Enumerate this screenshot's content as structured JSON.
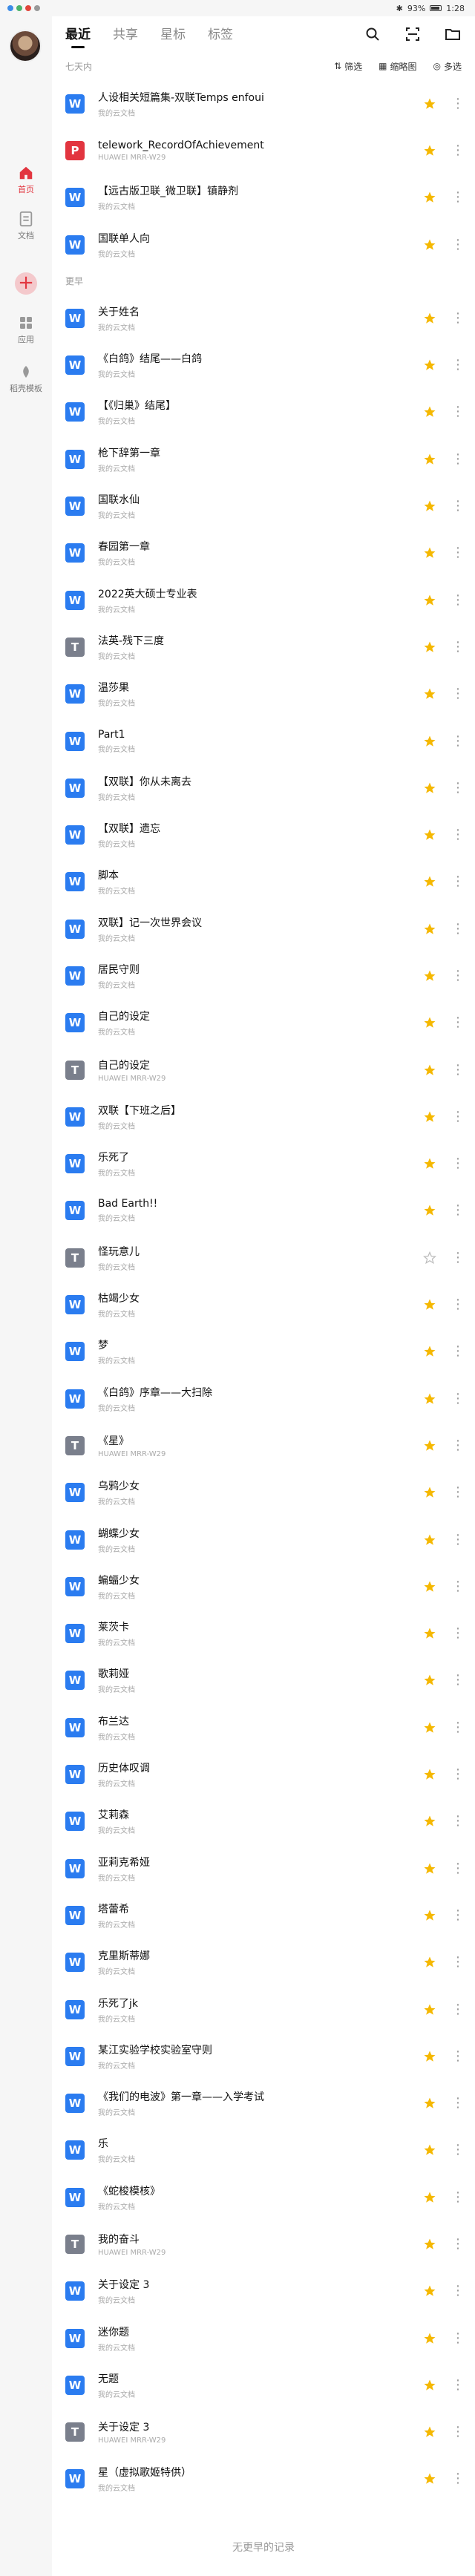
{
  "statusbar": {
    "battery": "93%",
    "time": "1:28"
  },
  "sidebar": {
    "items": [
      {
        "label": "首页",
        "icon": "home-icon"
      },
      {
        "label": "文档",
        "icon": "document-icon"
      },
      {
        "label": "应用",
        "icon": "apps-icon"
      },
      {
        "label": "稻壳模板",
        "icon": "template-icon"
      }
    ],
    "add_label": "+"
  },
  "tabs": [
    "最近",
    "共享",
    "星标",
    "标签"
  ],
  "toolbar": {
    "filter_label": "筛选",
    "thumb_label": "缩略图",
    "multi_label": "多选"
  },
  "sections": [
    {
      "title": "七天内",
      "items": [
        {
          "name": "人设相关短篇集-双联Temps enfoui",
          "sub": "我的云文档",
          "type": "w",
          "starred": true
        },
        {
          "name": "telework_RecordOfAchievement",
          "sub": "HUAWEI MRR-W29",
          "type": "p",
          "starred": true
        },
        {
          "name": "【远古版卫联_微卫联】镇静剂",
          "sub": "我的云文档",
          "type": "w",
          "starred": true
        },
        {
          "name": "国联单人向",
          "sub": "我的云文档",
          "type": "w",
          "starred": true
        }
      ]
    },
    {
      "title": "更早",
      "items": [
        {
          "name": "关于姓名",
          "sub": "我的云文档",
          "type": "w",
          "starred": true
        },
        {
          "name": "《白鸽》结尾——白鸽",
          "sub": "我的云文档",
          "type": "w",
          "starred": true
        },
        {
          "name": "【《归巢》结尾】",
          "sub": "我的云文档",
          "type": "w",
          "starred": true
        },
        {
          "name": "枪下辞第一章",
          "sub": "我的云文档",
          "type": "w",
          "starred": true
        },
        {
          "name": "国联水仙",
          "sub": "我的云文档",
          "type": "w",
          "starred": true
        },
        {
          "name": "春园第一章",
          "sub": "我的云文档",
          "type": "w",
          "starred": true
        },
        {
          "name": "2022英大硕士专业表",
          "sub": "我的云文档",
          "type": "w",
          "starred": true
        },
        {
          "name": "法英-残下三度",
          "sub": "我的云文档",
          "type": "t",
          "starred": true
        },
        {
          "name": "温莎果",
          "sub": "我的云文档",
          "type": "w",
          "starred": true
        },
        {
          "name": "Part1",
          "sub": "我的云文档",
          "type": "w",
          "starred": true
        },
        {
          "name": "【双联】你从未离去",
          "sub": "我的云文档",
          "type": "w",
          "starred": true
        },
        {
          "name": "【双联】遗忘",
          "sub": "我的云文档",
          "type": "w",
          "starred": true
        },
        {
          "name": "脚本",
          "sub": "我的云文档",
          "type": "w",
          "starred": true
        },
        {
          "name": "双联】记一次世界会议",
          "sub": "我的云文档",
          "type": "w",
          "starred": true
        },
        {
          "name": "居民守则",
          "sub": "我的云文档",
          "type": "w",
          "starred": true
        },
        {
          "name": "自己的设定",
          "sub": "我的云文档",
          "type": "w",
          "starred": true
        },
        {
          "name": "自己的设定",
          "sub": "HUAWEI MRR-W29",
          "type": "t",
          "starred": true
        },
        {
          "name": "双联【下班之后】",
          "sub": "我的云文档",
          "type": "w",
          "starred": true
        },
        {
          "name": "乐死了",
          "sub": "我的云文档",
          "type": "w",
          "starred": true
        },
        {
          "name": "Bad Earth!!",
          "sub": "我的云文档",
          "type": "w",
          "starred": true
        },
        {
          "name": "怪玩意儿",
          "sub": "我的云文档",
          "type": "t",
          "starred": false
        },
        {
          "name": "枯竭少女",
          "sub": "我的云文档",
          "type": "w",
          "starred": true
        },
        {
          "name": "梦",
          "sub": "我的云文档",
          "type": "w",
          "starred": true
        },
        {
          "name": "《白鸽》序章——大扫除",
          "sub": "我的云文档",
          "type": "w",
          "starred": true
        },
        {
          "name": "《星》",
          "sub": "HUAWEI MRR-W29",
          "type": "t",
          "starred": true
        },
        {
          "name": "乌鸦少女",
          "sub": "我的云文档",
          "type": "w",
          "starred": true
        },
        {
          "name": "蝴蝶少女",
          "sub": "我的云文档",
          "type": "w",
          "starred": true
        },
        {
          "name": "蝙蝠少女",
          "sub": "我的云文档",
          "type": "w",
          "starred": true
        },
        {
          "name": "莱茨卡",
          "sub": "我的云文档",
          "type": "w",
          "starred": true
        },
        {
          "name": "歌莉娅",
          "sub": "我的云文档",
          "type": "w",
          "starred": true
        },
        {
          "name": "布兰达",
          "sub": "我的云文档",
          "type": "w",
          "starred": true
        },
        {
          "name": "历史体叹调",
          "sub": "我的云文档",
          "type": "w",
          "starred": true
        },
        {
          "name": "艾莉森",
          "sub": "我的云文档",
          "type": "w",
          "starred": true
        },
        {
          "name": "亚莉克希娅",
          "sub": "我的云文档",
          "type": "w",
          "starred": true
        },
        {
          "name": "塔蕾希",
          "sub": "我的云文档",
          "type": "w",
          "starred": true
        },
        {
          "name": "克里斯蒂娜",
          "sub": "我的云文档",
          "type": "w",
          "starred": true
        },
        {
          "name": "乐死了jk",
          "sub": "我的云文档",
          "type": "w",
          "starred": true
        },
        {
          "name": "某江实验学校实验室守则",
          "sub": "我的云文档",
          "type": "w",
          "starred": true
        },
        {
          "name": "《我们的电波》第一章——入学考试",
          "sub": "我的云文档",
          "type": "w",
          "starred": true
        },
        {
          "name": "乐",
          "sub": "我的云文档",
          "type": "w",
          "starred": true
        },
        {
          "name": "《蛇梭模核》",
          "sub": "我的云文档",
          "type": "w",
          "starred": true
        },
        {
          "name": "我的奋斗",
          "sub": "HUAWEI MRR-W29",
          "type": "t",
          "starred": true
        },
        {
          "name": "关于设定 3",
          "sub": "我的云文档",
          "type": "w",
          "starred": true
        },
        {
          "name": "迷你题",
          "sub": "我的云文档",
          "type": "w",
          "starred": true
        },
        {
          "name": "无题",
          "sub": "我的云文档",
          "type": "w",
          "starred": true
        },
        {
          "name": "关于设定 3",
          "sub": "HUAWEI MRR-W29",
          "type": "t",
          "starred": true
        },
        {
          "name": "星（虚拟歌姬特供）",
          "sub": "我的云文档",
          "type": "w",
          "starred": true
        }
      ]
    }
  ],
  "footer": "无更早的记录",
  "colors": {
    "accent": "#e2353f",
    "doc_blue": "#2b7cf0",
    "star": "#f5b800"
  }
}
